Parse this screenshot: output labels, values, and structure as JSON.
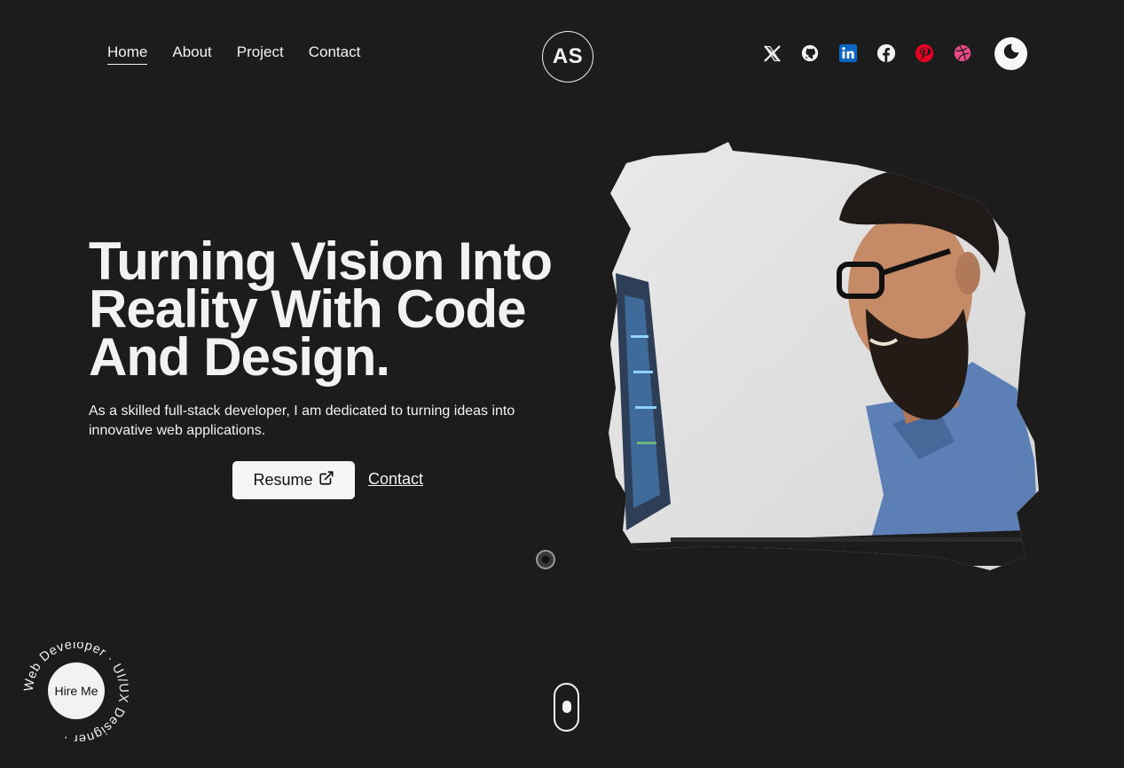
{
  "nav": {
    "items": [
      {
        "label": "Home",
        "active": true
      },
      {
        "label": "About",
        "active": false
      },
      {
        "label": "Project",
        "active": false
      },
      {
        "label": "Contact",
        "active": false
      }
    ]
  },
  "logo": {
    "text": "AS"
  },
  "social": {
    "icons": [
      "x-icon",
      "github-icon",
      "linkedin-icon",
      "facebook-icon",
      "pinterest-icon",
      "dribbble-icon"
    ],
    "colors": {
      "linkedin": "#0a66c2",
      "pinterest": "#e60023",
      "dribbble": "#ea4c89"
    }
  },
  "theme_toggle": {
    "icon": "moon-icon"
  },
  "hero": {
    "title_line1": "Turning Vision Into",
    "title_line2": "Reality With Code",
    "title_line3": "And Design.",
    "description": "As a skilled full-stack developer, I am dedicated to turning ideas into innovative web applications.",
    "resume_label": "Resume",
    "contact_label": "Contact"
  },
  "hire": {
    "badge_label": "Hire Me",
    "circular_text": "Web Developer · UI/UX Designer · "
  },
  "colors": {
    "background": "#1c1c1c",
    "text": "#f2f2f2"
  }
}
